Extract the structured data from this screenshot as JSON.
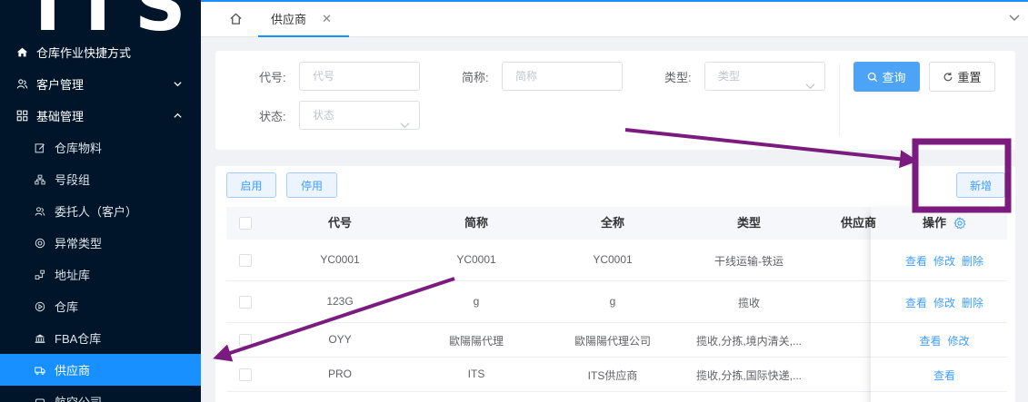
{
  "logo": {
    "text": "ITS"
  },
  "sidebar": {
    "items": [
      {
        "label": "仓库作业快捷方式",
        "icon": "home-icon"
      },
      {
        "label": "客户管理",
        "icon": "users-icon",
        "expanded": false
      },
      {
        "label": "基础管理",
        "icon": "grid-icon",
        "expanded": true
      }
    ],
    "sub_items": [
      {
        "label": "仓库物料",
        "icon": "edit-icon"
      },
      {
        "label": "号段组",
        "icon": "org-icon"
      },
      {
        "label": "委托人（客户）",
        "icon": "users-icon"
      },
      {
        "label": "异常类型",
        "icon": "circle-icon"
      },
      {
        "label": "地址库",
        "icon": "sitemap-icon"
      },
      {
        "label": "仓库",
        "icon": "play-circle-icon"
      },
      {
        "label": "FBA仓库",
        "icon": "bank-icon"
      },
      {
        "label": "供应商",
        "icon": "truck-icon",
        "active": true
      },
      {
        "label": "航空公司",
        "icon": "plane-icon"
      }
    ]
  },
  "tabs": {
    "active_label": "供应商"
  },
  "filter": {
    "code_label": "代号:",
    "code_placeholder": "代号",
    "short_label": "简称:",
    "short_placeholder": "简称",
    "type_label": "类型:",
    "type_placeholder": "类型",
    "status_label": "状态:",
    "status_placeholder": "状态",
    "query_label": "查询",
    "reset_label": "重置"
  },
  "toolbar": {
    "enable_label": "启用",
    "disable_label": "停用",
    "add_label": "新增"
  },
  "table": {
    "headers": {
      "code": "代号",
      "short": "简称",
      "full": "全称",
      "type": "类型",
      "supplier": "供应商",
      "ops": "操作"
    },
    "rows": [
      {
        "code": "YC0001",
        "short": "YC0001",
        "full": "YC0001",
        "type": "干线运输-铁运",
        "ops": [
          "查看",
          "修改",
          "删除"
        ]
      },
      {
        "code": "123G",
        "short": "g",
        "full": "g",
        "type": "揽收",
        "ops": [
          "查看",
          "修改",
          "删除"
        ]
      },
      {
        "code": "OYY",
        "short": "歐陽陽代理",
        "full": "歐陽陽代理公司",
        "type": "揽收,分拣,境内清关,...",
        "ops": [
          "查看",
          "修改"
        ]
      },
      {
        "code": "PRO",
        "short": "ITS",
        "full": "ITS供应商",
        "type": "揽收,分拣,国际快递,...",
        "ops": [
          "查看"
        ]
      }
    ]
  },
  "colors": {
    "sidebar_bg": "#001529",
    "active": "#1890ff",
    "annotation": "#7b1a7f"
  }
}
